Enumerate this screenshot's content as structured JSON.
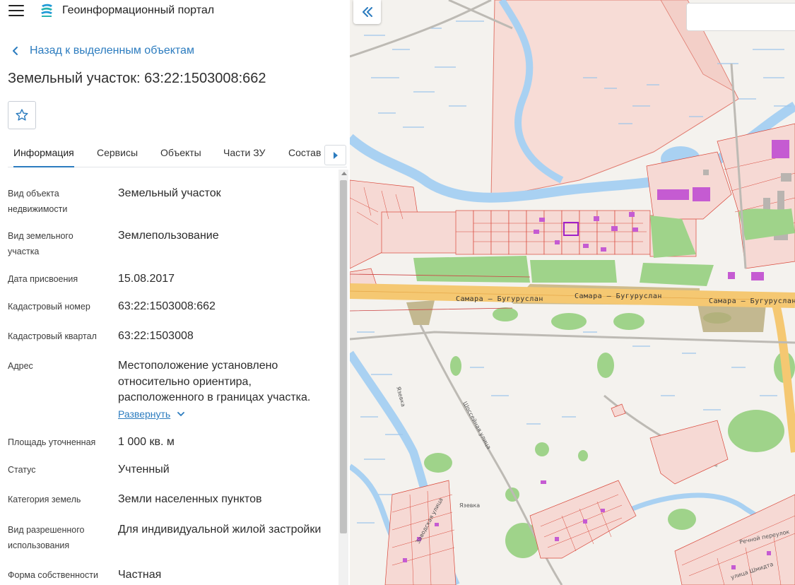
{
  "header": {
    "portal_title": "Геоинформационный портал"
  },
  "nav": {
    "back_label": "Назад к выделенным объектам"
  },
  "object": {
    "title": "Земельный участок: 63:22:1503008:662"
  },
  "tabs": [
    {
      "label": "Информация",
      "active": true
    },
    {
      "label": "Сервисы",
      "active": false
    },
    {
      "label": "Объекты",
      "active": false
    },
    {
      "label": "Части ЗУ",
      "active": false
    },
    {
      "label": "Состав",
      "active": false
    }
  ],
  "properties": [
    {
      "label": "Вид объекта недвижимости",
      "value": "Земельный участок"
    },
    {
      "label": "Вид земельного участка",
      "value": "Землепользование"
    },
    {
      "label": "Дата присвоения",
      "value": "15.08.2017"
    },
    {
      "label": "Кадастровый номер",
      "value": "63:22:1503008:662"
    },
    {
      "label": "Кадастровый квартал",
      "value": "63:22:1503008"
    },
    {
      "label": "Адрес",
      "value": "Местоположение установлено относительно ориентира, расположенного в границах участка."
    },
    {
      "label": "Площадь уточненная",
      "value": "1 000 кв. м"
    },
    {
      "label": "Статус",
      "value": "Учтенный"
    },
    {
      "label": "Категория земель",
      "value": "Земли населенных пунктов"
    },
    {
      "label": "Вид разрешенного использования",
      "value": "Для индивидуальной жилой застройки"
    },
    {
      "label": "Форма собственности",
      "value": "Частная"
    }
  ],
  "address_expand_label": "Развернуть",
  "map": {
    "road_labels": [
      "Самара — Бугуруслан",
      "Самара — Бугуруслан",
      "Самара — Бугуруслан"
    ],
    "street_labels": [
      "Шоссейная улица",
      "Заводская улица",
      "Речной переулок",
      "улица Шмидта",
      "Язевка",
      "Язевка"
    ]
  },
  "colors": {
    "accent": "#2c7cbf",
    "parcel_fill": "#f6d9d4",
    "parcel_border": "#d9483b",
    "water": "#a9d1f2",
    "forest": "#9fd38a",
    "road": "#f5c872",
    "selected_parcel": "#a020c8"
  },
  "icons": {
    "menu": "hamburger-menu-icon",
    "logo": "portal-logo-icon",
    "back": "chevron-left-icon",
    "favorite": "star-outline-icon",
    "tabs_scroll": "triangle-right-icon",
    "expand": "chevron-down-icon",
    "collapse_panel": "double-chevron-left-icon"
  }
}
